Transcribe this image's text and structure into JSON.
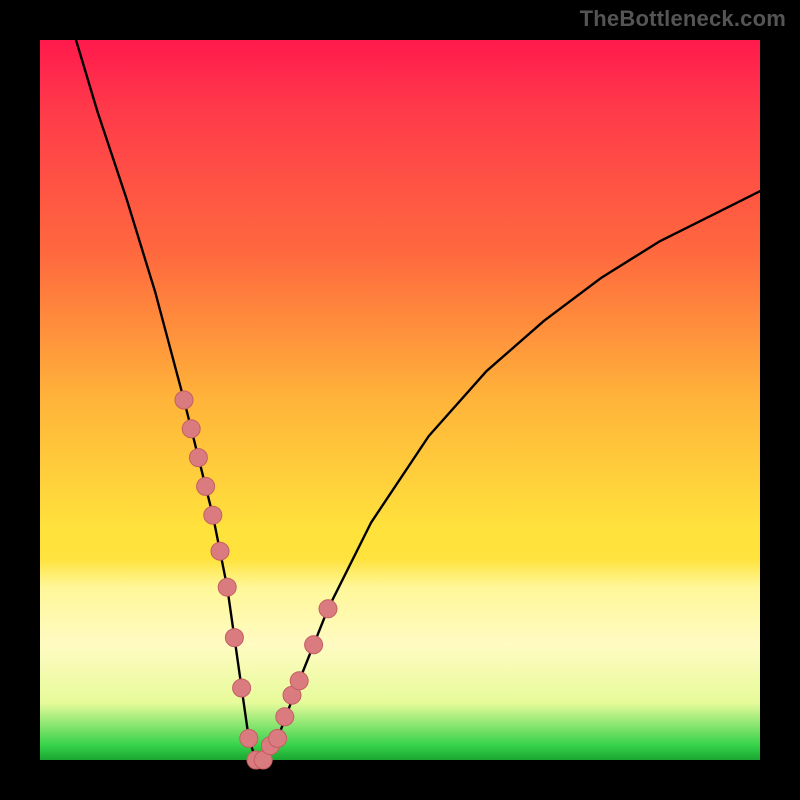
{
  "watermark": "TheBottleneck.com",
  "colors": {
    "frame": "#000000",
    "gradient_top": "#ff1a4d",
    "gradient_mid_orange": "#ffb43a",
    "gradient_yellow": "#ffe23c",
    "gradient_green": "#1aa531",
    "curve_stroke": "#000000",
    "marker_fill": "#d97b7f",
    "marker_stroke": "#c55e63"
  },
  "chart_data": {
    "type": "line",
    "title": "",
    "xlabel": "",
    "ylabel": "",
    "xlim": [
      0,
      100
    ],
    "ylim": [
      0,
      100
    ],
    "grid": false,
    "legend": false,
    "series": [
      {
        "name": "bottleneck-curve",
        "x": [
          5,
          8,
          12,
          16,
          20,
          22,
          24,
          26,
          27,
          28,
          29,
          30,
          31,
          33,
          36,
          40,
          46,
          54,
          62,
          70,
          78,
          86,
          94,
          100
        ],
        "y": [
          100,
          90,
          78,
          65,
          50,
          42,
          34,
          24,
          17,
          10,
          3,
          0,
          0,
          3,
          11,
          21,
          33,
          45,
          54,
          61,
          67,
          72,
          76,
          79
        ]
      }
    ],
    "markers": {
      "name": "highlight-points",
      "x": [
        20,
        21,
        22,
        23,
        24,
        25,
        26,
        27,
        28,
        29,
        30,
        31,
        32,
        33,
        34,
        35,
        36,
        38,
        40
      ],
      "y": [
        50,
        46,
        42,
        38,
        34,
        29,
        24,
        17,
        10,
        3,
        0,
        0,
        2,
        3,
        6,
        9,
        11,
        16,
        21
      ]
    }
  }
}
